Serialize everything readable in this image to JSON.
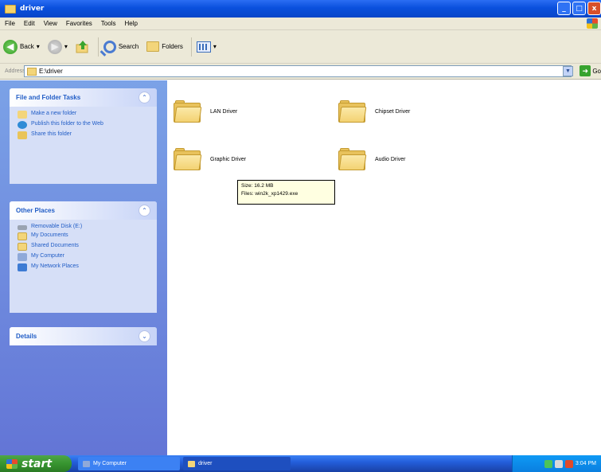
{
  "window": {
    "title": "driver"
  },
  "titlebar_buttons": [
    "_",
    "□",
    "x"
  ],
  "menu": [
    "File",
    "Edit",
    "View",
    "Favorites",
    "Tools",
    "Help"
  ],
  "toolbar": {
    "back_label": "Back",
    "search_label": "Search",
    "folders_label": "Folders"
  },
  "address": {
    "label": "Address",
    "value": "E:\\driver",
    "go_label": "Go"
  },
  "left_pane": {
    "file_tasks": {
      "title": "File and Folder Tasks",
      "items": [
        "Make a new folder",
        "Publish this folder to the Web",
        "Share this folder"
      ]
    },
    "other_places": {
      "title": "Other Places",
      "items": [
        "Removable Disk (E:)",
        "My Documents",
        "Shared Documents",
        "My Computer",
        "My Network Places"
      ]
    },
    "details": {
      "title": "Details"
    }
  },
  "folders": [
    {
      "name": "LAN Driver"
    },
    {
      "name": "Chipset Driver"
    },
    {
      "name": "Graphic Driver"
    },
    {
      "name": "Audio Driver"
    }
  ],
  "tooltip": {
    "size": "Size: 16.2 MB",
    "files": "Files: win2k_xp1429.exe"
  },
  "taskbar": {
    "start_label": "start",
    "tasks": [
      "My Computer",
      "driver"
    ],
    "clock": "3:04 PM"
  },
  "colors": {
    "title_bar": "#0a50dd",
    "left_pane": "#6f8ce0",
    "taskbar": "#245edb",
    "start_button": "#379530",
    "panel_title": "#215dc6"
  }
}
